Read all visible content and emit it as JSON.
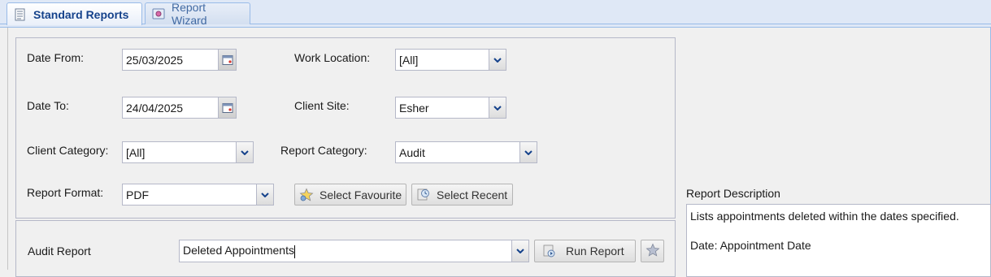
{
  "tabs": [
    {
      "label": "Standard Reports",
      "icon": "report-document-icon",
      "active": true
    },
    {
      "label": "Report Wizard",
      "icon": "wizard-icon",
      "active": false
    }
  ],
  "form": {
    "date_from": {
      "label": "Date From:",
      "value": "25/03/2025"
    },
    "date_to": {
      "label": "Date To:",
      "value": "24/04/2025"
    },
    "work_location": {
      "label": "Work Location:",
      "value": "[All]"
    },
    "client_site": {
      "label": "Client Site:",
      "value": "Esher"
    },
    "client_category": {
      "label": "Client Category:",
      "value": "[All]"
    },
    "report_category": {
      "label": "Report Category:",
      "value": "Audit"
    },
    "report_format": {
      "label": "Report Format:",
      "value": "PDF"
    }
  },
  "buttons": {
    "select_favourite": "Select Favourite",
    "select_recent": "Select Recent",
    "run_report": "Run Report"
  },
  "report": {
    "label": "Audit Report",
    "value": "Deleted Appointments"
  },
  "description": {
    "label": "Report Description",
    "line1": "Lists appointments deleted within the dates specified.",
    "line2": "Date: Appointment Date"
  },
  "colors": {
    "tab_active_text": "#15428b",
    "tab_bar": "#dfe8f6",
    "border_blue": "#99bbe8"
  }
}
